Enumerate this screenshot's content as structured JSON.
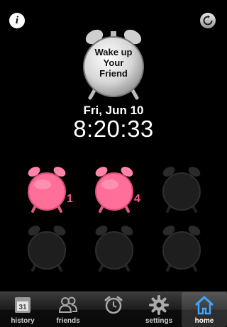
{
  "header": {
    "info_icon": "i",
    "refresh_icon": "refresh-icon"
  },
  "main_clock": {
    "label_line1": "Wake up",
    "label_line2": "Your",
    "label_line3": "Friend"
  },
  "date": "Fri, Jun 10",
  "time": "8:20:33",
  "alarms": [
    {
      "active": true,
      "count": "1"
    },
    {
      "active": true,
      "count": "4"
    },
    {
      "active": false,
      "count": ""
    },
    {
      "active": false,
      "count": ""
    },
    {
      "active": false,
      "count": ""
    },
    {
      "active": false,
      "count": ""
    }
  ],
  "tabs": [
    {
      "label": "history",
      "icon": "calendar-icon",
      "calendar_day": "31"
    },
    {
      "label": "friends",
      "icon": "friends-icon"
    },
    {
      "label": "",
      "icon": "alarm-clock-icon"
    },
    {
      "label": "settings",
      "icon": "gear-icon"
    },
    {
      "label": "home",
      "icon": "home-icon"
    }
  ],
  "colors": {
    "accent_pink": "#ff6f97",
    "home_blue": "#3fa6ff"
  }
}
